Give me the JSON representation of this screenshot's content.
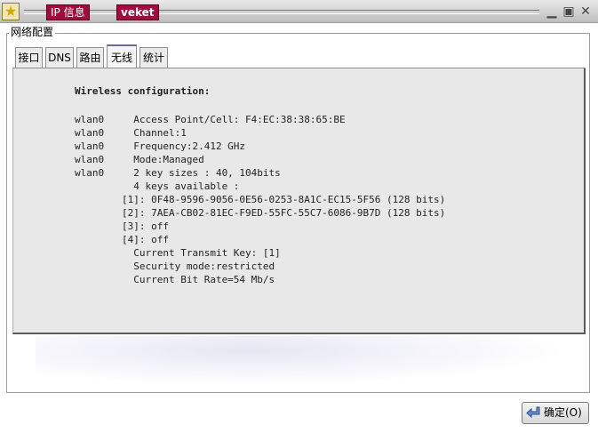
{
  "titlebar": {
    "badge_ip": "IP 信息",
    "badge_app": "veket",
    "icons": [
      "star-icon",
      "minimize-icon",
      "maximize-icon",
      "close-icon"
    ]
  },
  "group": {
    "legend": "网络配置"
  },
  "tabs": [
    {
      "label": "接口",
      "active": false
    },
    {
      "label": "DNS",
      "active": false
    },
    {
      "label": "路由",
      "active": false
    },
    {
      "label": "无线",
      "active": true
    },
    {
      "label": "统计",
      "active": false
    }
  ],
  "panel": {
    "heading": "Wireless configuration:",
    "lines": [
      "wlan0     Access Point/Cell: F4:EC:38:38:65:BE",
      "wlan0     Channel:1",
      "wlan0     Frequency:2.412 GHz",
      "wlan0     Mode:Managed",
      "wlan0     2 key sizes : 40, 104bits",
      "          4 keys available :",
      "        [1]: 0F48-9596-9056-0E56-0253-8A1C-EC15-5F56 (128 bits)",
      "        [2]: 7AEA-CB02-81EC-F9ED-55FC-55C7-6086-9B7D (128 bits)",
      "        [3]: off",
      "        [4]: off",
      "          Current Transmit Key: [1]",
      "          Security mode:restricted",
      "          Current Bit Rate=54 Mb/s"
    ]
  },
  "buttons": {
    "ok_label": "确定(O)"
  },
  "colors": {
    "badge_bg": "#a00c3c",
    "panel_bg": "#e8e8e8",
    "tab_active_border": "#6a6a9a"
  }
}
